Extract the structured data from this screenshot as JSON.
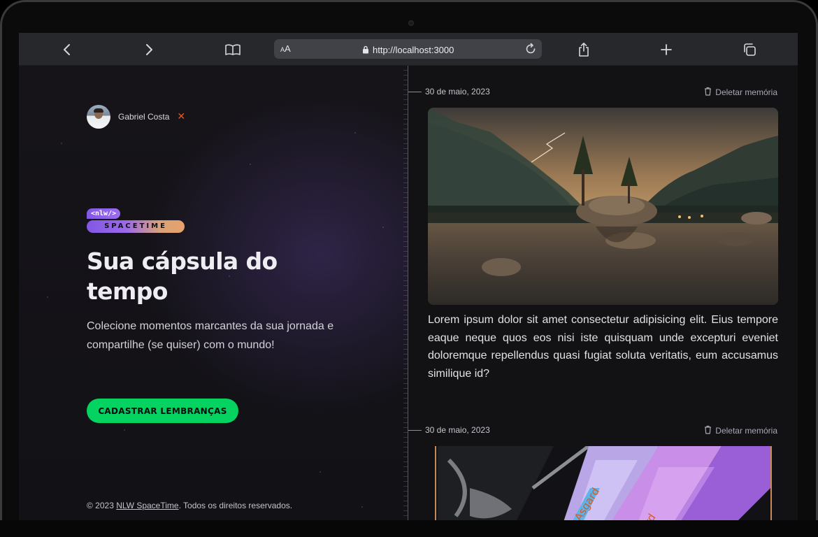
{
  "browser": {
    "aa_label": "AA",
    "url": "http://localhost:3000"
  },
  "user": {
    "name": "Gabriel Costa"
  },
  "brand": {
    "logo_top": "<nlw/>",
    "logo_bottom": "SPACETIME"
  },
  "hero": {
    "title": "Sua cápsula do tempo",
    "subtitle": "Colecione momentos marcantes da sua jornada e compartilhe (se quiser) com o mundo!",
    "cta_label": "CADASTRAR LEMBRANÇAS"
  },
  "footer": {
    "prefix": "© 2023 ",
    "link": "NLW SpaceTime",
    "suffix": ". Todos os direitos reservados."
  },
  "memories": [
    {
      "date": "30 de maio, 2023",
      "delete_label": "Deletar memória",
      "text": "Lorem ipsum dolor sit amet consectetur adipisicing elit. Eius tempore eaque neque quos eos nisi iste quisquam unde excepturi eveniet doloremque repellendus quasi fugiat soluta veritatis, eum accusamus similique id?"
    },
    {
      "date": "30 de maio, 2023",
      "delete_label": "Deletar memória",
      "image_text_1": "Asgard",
      "image_text_2": "rd"
    }
  ],
  "colors": {
    "accent_green": "#04d361",
    "accent_purple": "#8257e5",
    "close_orange": "#e05b2c",
    "background": "#121215"
  },
  "icons": {
    "toolbar": [
      "chevron-left-icon",
      "chevron-right-icon",
      "book-icon",
      "lock-icon",
      "reload-icon",
      "share-icon",
      "plus-icon",
      "tabs-icon"
    ],
    "memory": [
      "trash-icon"
    ]
  }
}
